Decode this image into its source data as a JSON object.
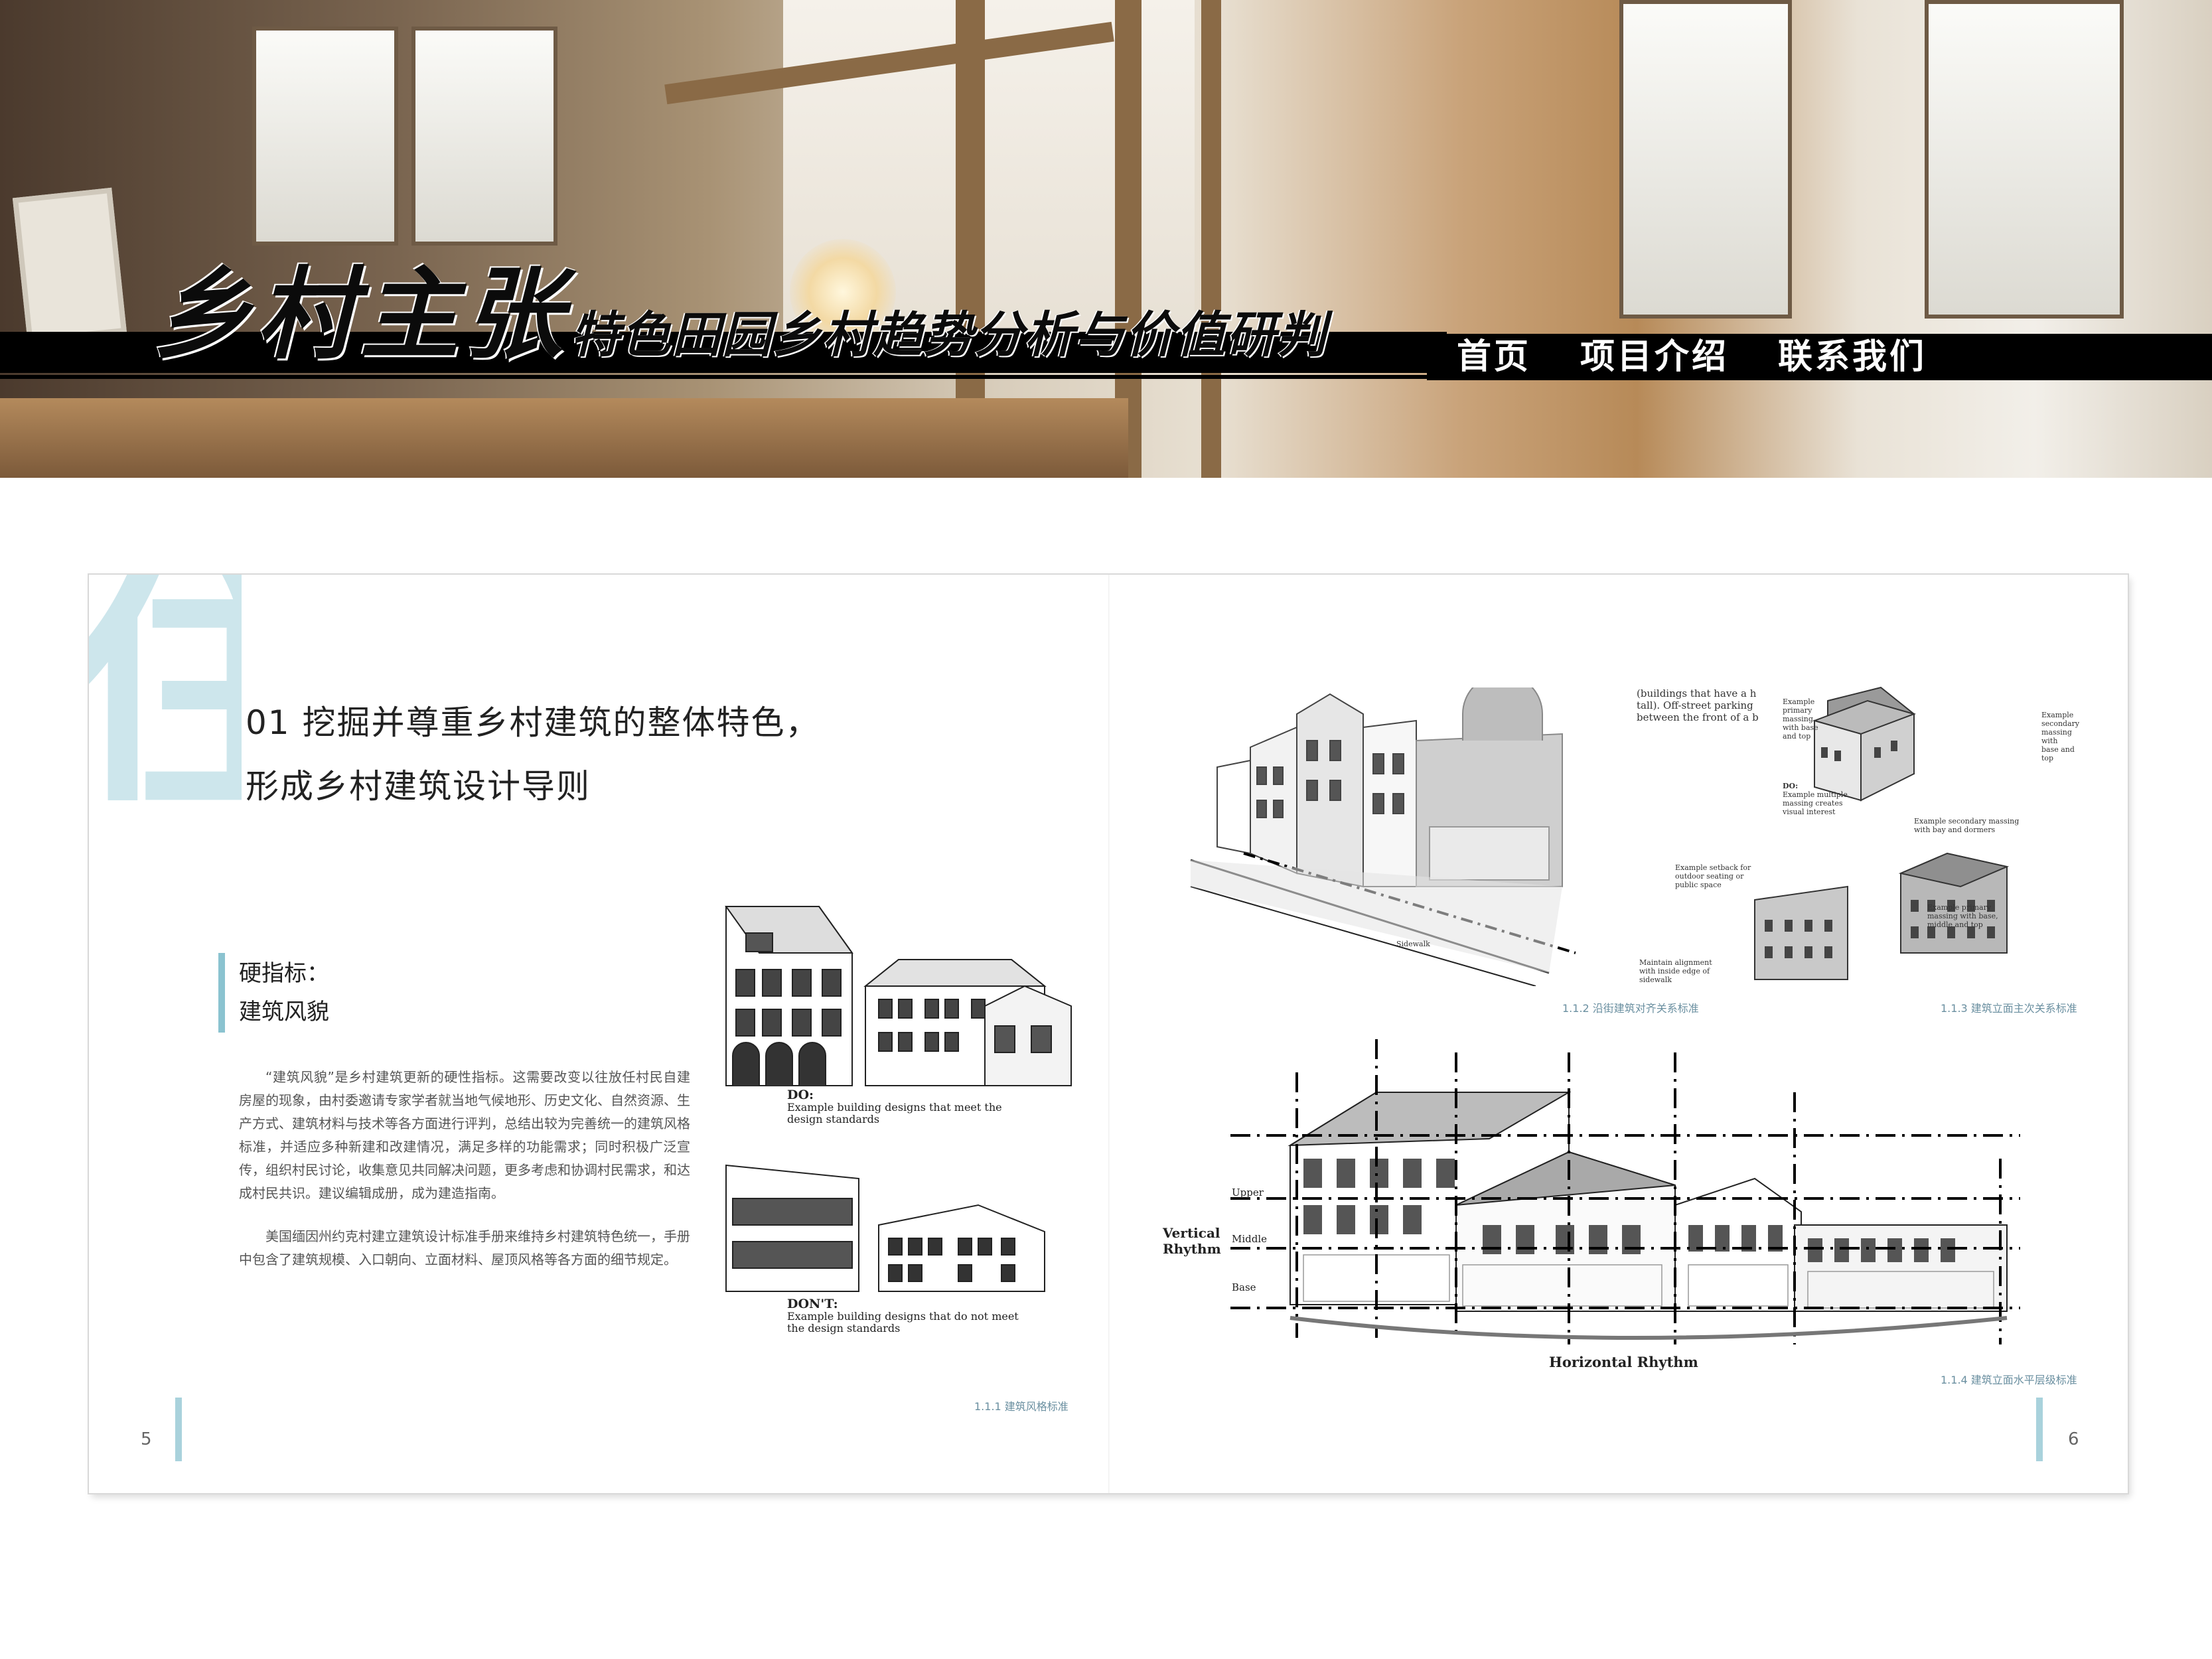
{
  "banner": {
    "title": "乡村主张",
    "subtitle": "特色田园乡村趋势分析与价值研判"
  },
  "nav": {
    "items": [
      "首页",
      "项目介绍",
      "联系我们"
    ]
  },
  "spread": {
    "big_glyph": "住",
    "title_line1": "01 挖掘并尊重乡村建筑的整体特色，",
    "title_line2": "形成乡村建筑设计导则",
    "subhead_line1": "硬指标：",
    "subhead_line2": "建筑风貌",
    "paragraph1": "“建筑风貌”是乡村建筑更新的硬性指标。这需要改变以往放任村民自建房屋的现象，由村委邀请专家学者就当地气候地形、历史文化、自然资源、生产方式、建筑材料与技术等各方面进行评判，总结出较为完善统一的建筑风格标准，并适应多种新建和改建情况，满足多样的功能需求；同时积极广泛宣传，组织村民讨论，收集意见共同解决问题，更多考虑和协调村民需求，和达成村民共识。建议编辑成册，成为建造指南。",
    "paragraph2": "美国缅因州约克村建立建筑设计标准手册来维持乡村建筑特色统一，手册中包含了建筑规模、入口朝向、立面材料、屋顶风格等各方面的细节规定。",
    "page_left": "5",
    "page_right": "6"
  },
  "figures": {
    "fig1": {
      "do_title": "DO:",
      "do_text_1": "Example building designs that meet the",
      "do_text_2": "design standards",
      "dont_title": "DON'T:",
      "dont_text_1": "Example building designs that do not meet",
      "dont_text_2": "the design standards",
      "caption": "1.1.1 建筑风格标准"
    },
    "fig2": {
      "top_text_1": "(buildings that have a h",
      "top_text_2": "tall). Off-street parking",
      "top_text_3": "between the front of a b",
      "setback_1": "Example setback for",
      "setback_2": "outdoor seating or",
      "setback_3": "public space",
      "sidewalk": "Sidewalk",
      "align_1": "Maintain alignment",
      "align_2": "with inside edge of",
      "align_3": "sidewalk",
      "caption": "1.1.2 沿街建筑对齐关系标准"
    },
    "fig3": {
      "primary_1": "Example",
      "primary_2": "primary",
      "primary_3": "massing",
      "primary_4": "with base",
      "primary_5": "and top",
      "secondary_1": "Example",
      "secondary_2": "secondary",
      "secondary_3": "massing with",
      "secondary_4": "base and top",
      "do_title": "DO:",
      "do_1": "Example multiple",
      "do_2": "massing creates",
      "do_3": "visual interest",
      "bay_1": "Example secondary massing",
      "bay_2": "with bay and dormers",
      "base_1": "Example primary",
      "base_2": "massing with base,",
      "base_3": "middle and top",
      "caption": "1.1.3 建筑立面主次关系标准"
    },
    "fig4": {
      "upper": "Upper",
      "middle": "Middle",
      "base": "Base",
      "vertical_1": "Vertical",
      "vertical_2": "Rhythm",
      "horizontal": "Horizontal Rhythm",
      "caption": "1.1.4 建筑立面水平层级标准"
    }
  }
}
